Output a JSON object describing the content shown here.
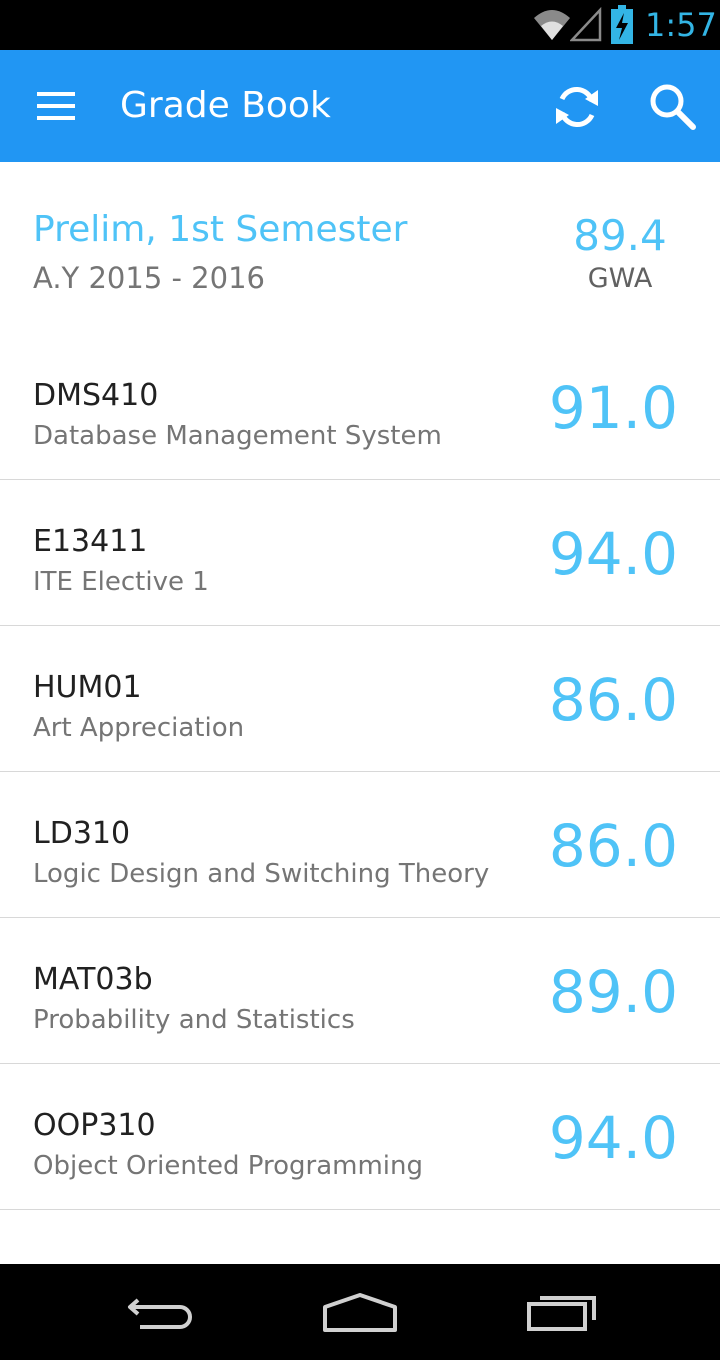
{
  "status_bar": {
    "time": "1:57",
    "icons": [
      "wifi-icon",
      "signal-icon",
      "battery-charging-icon"
    ]
  },
  "app_bar": {
    "title": "Grade Book",
    "icons": [
      "menu-icon",
      "refresh-icon",
      "search-icon"
    ],
    "color": "#2196f3"
  },
  "summary": {
    "semester": "Prelim, 1st Semester",
    "academic_year": "A.Y 2015 - 2016",
    "gwa_value": "89.4",
    "gwa_label": "GWA"
  },
  "subjects": [
    {
      "code": "DMS410",
      "name": "Database Management System",
      "grade": "91.0"
    },
    {
      "code": "E13411",
      "name": "ITE Elective 1",
      "grade": "94.0"
    },
    {
      "code": "HUM01",
      "name": "Art Appreciation",
      "grade": "86.0"
    },
    {
      "code": "LD310",
      "name": "Logic Design and Switching Theory",
      "grade": "86.0"
    },
    {
      "code": "MAT03b",
      "name": "Probability and Statistics",
      "grade": "89.0"
    },
    {
      "code": "OOP310",
      "name": "Object Oriented Programming",
      "grade": "94.0"
    },
    {
      "code": "",
      "name": "",
      "grade": ""
    }
  ],
  "nav_bar": {
    "icons": [
      "back-icon",
      "home-icon",
      "recents-icon"
    ]
  },
  "colors": {
    "accent": "#4fc3f7",
    "primary_text": "#212121",
    "secondary_text": "#757575"
  }
}
